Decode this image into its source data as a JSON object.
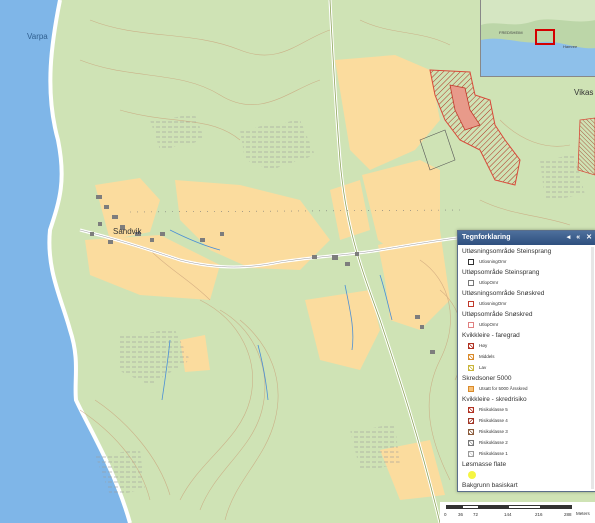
{
  "places": {
    "varpa": "Varpa",
    "sandvik": "Sandvik",
    "vikas": "Vikas"
  },
  "overview": {
    "label": "FREDSHEIM",
    "label2": "Hamree"
  },
  "legend": {
    "title": "Tegnforklaring",
    "controls": [
      "◂",
      "«",
      "✕"
    ],
    "groups": [
      {
        "title": "Utløsningsområde Steinsprang",
        "items": [
          {
            "label": "UtlosningOmr",
            "swatch": "outline-black"
          }
        ]
      },
      {
        "title": "Utløpsområde Steinsprang",
        "items": [
          {
            "label": "UtlopOmr",
            "swatch": "outline-gray"
          }
        ]
      },
      {
        "title": "Utløsningsområde Snøskred",
        "items": [
          {
            "label": "UtlosningOmr",
            "swatch": "outline-red"
          }
        ]
      },
      {
        "title": "Utløpsområde Snøskred",
        "items": [
          {
            "label": "UtlopOmr",
            "swatch": "outline-pink"
          }
        ]
      },
      {
        "title": "Kvikkleire - faregrad",
        "items": [
          {
            "label": "Høy",
            "swatch": "hatch-red"
          },
          {
            "label": "Middels",
            "swatch": "hatch-orange"
          },
          {
            "label": "Lav",
            "swatch": "hatch-yellow"
          }
        ]
      },
      {
        "title": "Skredsoner 5000",
        "items": [
          {
            "label": "Utsatt for 5000 Årsskred",
            "swatch": "fill-orange"
          }
        ]
      },
      {
        "title": "Kvikkleire - skredrisiko",
        "items": [
          {
            "label": "Risikoklasse 5",
            "swatch": "hatch-red"
          },
          {
            "label": "Risikoklasse 4",
            "swatch": "hatch-red2"
          },
          {
            "label": "Risikoklasse 3",
            "swatch": "hatch-brown"
          },
          {
            "label": "Risikoklasse 2",
            "swatch": "hatch-gray"
          },
          {
            "label": "Risikoklasse 1",
            "swatch": "hatch-light"
          }
        ]
      },
      {
        "title": "Løsmasse flate",
        "items": [
          {
            "label": "",
            "swatch": "dot-yellow"
          }
        ]
      },
      {
        "title": "Bakgrunn basiskart",
        "items": []
      }
    ]
  },
  "scalebar": {
    "ticks": [
      "0",
      "36",
      "72",
      "144",
      "216",
      "288"
    ],
    "unit": "Meters"
  },
  "colors": {
    "forest": "#cfe3b5",
    "field": "#fbdc9e",
    "water": "#7fb6e8",
    "hazard": "#d94a3a"
  }
}
